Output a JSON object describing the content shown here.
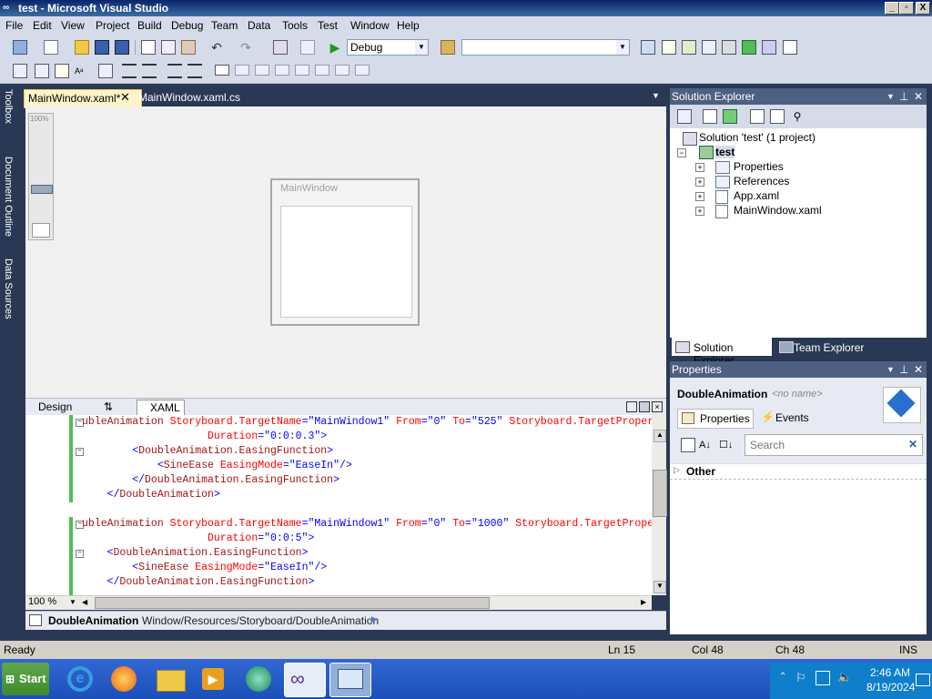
{
  "window": {
    "title": "test - Microsoft Visual Studio",
    "caption_buttons": [
      "_",
      "▫",
      "X"
    ]
  },
  "menu": [
    "File",
    "Edit",
    "View",
    "Project",
    "Build",
    "Debug",
    "Team",
    "Data",
    "Tools",
    "Test",
    "Window",
    "Help"
  ],
  "toolbar": {
    "config": "Debug",
    "platform": ""
  },
  "left_dock": [
    "Toolbox",
    "Document Outline",
    "Data Sources"
  ],
  "doc_tabs": [
    {
      "label": "MainWindow.xaml*",
      "active": true
    },
    {
      "label": "MainWindow.xaml.cs",
      "active": false
    }
  ],
  "designer": {
    "zoom_label": "100%",
    "window_title": "MainWindow"
  },
  "split_tabs": {
    "design": "Design",
    "swap": "⇅",
    "xaml": "XAML"
  },
  "code_lines": [
    [
      [
        "tg",
        "ubleAnimation "
      ],
      [
        "at",
        "Storyboard.TargetName"
      ],
      [
        "br",
        "="
      ],
      [
        "vl",
        "\"MainWindow1\""
      ],
      [
        "at",
        " From"
      ],
      [
        "br",
        "="
      ],
      [
        "vl",
        "\"0\""
      ],
      [
        "at",
        " To"
      ],
      [
        "br",
        "="
      ],
      [
        "vl",
        "\"525\""
      ],
      [
        "at",
        " Storyboard.TargetProperty"
      ]
    ],
    [
      [
        "at",
        "                    Duration"
      ],
      [
        "br",
        "="
      ],
      [
        "vl",
        "\"0:0:0.3\""
      ],
      [
        "br",
        ">"
      ]
    ],
    [
      [
        "br",
        "        <"
      ],
      [
        "tg",
        "DoubleAnimation.EasingFunction"
      ],
      [
        "br",
        ">"
      ]
    ],
    [
      [
        "br",
        "            <"
      ],
      [
        "tg",
        "SineEase"
      ],
      [
        "at",
        " EasingMode"
      ],
      [
        "br",
        "="
      ],
      [
        "vl",
        "\"EaseIn\""
      ],
      [
        "br",
        "/>"
      ]
    ],
    [
      [
        "br",
        "        </"
      ],
      [
        "tg",
        "DoubleAnimation.EasingFunction"
      ],
      [
        "br",
        ">"
      ]
    ],
    [
      [
        "br",
        "    </"
      ],
      [
        "tg",
        "DoubleAnimation"
      ],
      [
        "br",
        ">"
      ]
    ],
    [
      [
        "br",
        ""
      ]
    ],
    [
      [
        "tg",
        "ubleAnimation "
      ],
      [
        "at",
        "Storyboard.TargetName"
      ],
      [
        "br",
        "="
      ],
      [
        "vl",
        "\"MainWindow1\""
      ],
      [
        "at",
        " From"
      ],
      [
        "br",
        "="
      ],
      [
        "vl",
        "\"0\""
      ],
      [
        "at",
        " To"
      ],
      [
        "br",
        "="
      ],
      [
        "vl",
        "\"1000\""
      ],
      [
        "at",
        " Storyboard.TargetPropert"
      ]
    ],
    [
      [
        "at",
        "                    Duration"
      ],
      [
        "br",
        "="
      ],
      [
        "vl",
        "\"0:0:5\""
      ],
      [
        "br",
        ">"
      ]
    ],
    [
      [
        "br",
        "    <"
      ],
      [
        "tg",
        "DoubleAnimation.EasingFunction"
      ],
      [
        "br",
        ">"
      ]
    ],
    [
      [
        "br",
        "        <"
      ],
      [
        "tg",
        "SineEase"
      ],
      [
        "at",
        " EasingMode"
      ],
      [
        "br",
        "="
      ],
      [
        "vl",
        "\"EaseIn\""
      ],
      [
        "br",
        "/>"
      ]
    ],
    [
      [
        "br",
        "    </"
      ],
      [
        "tg",
        "DoubleAnimation.EasingFunction"
      ],
      [
        "br",
        ">"
      ]
    ]
  ],
  "code_zoom": "100 %",
  "navbar": {
    "element": "DoubleAnimation",
    "path": "Window/Resources/Storyboard/DoubleAnimation"
  },
  "solution_explorer": {
    "title": "Solution Explorer",
    "solution": "Solution 'test' (1 project)",
    "project": "test",
    "items": [
      "Properties",
      "References",
      "App.xaml",
      "MainWindow.xaml"
    ],
    "bottom_tabs": [
      "Solution Explorer",
      "Team Explorer"
    ]
  },
  "properties": {
    "title": "Properties",
    "object_type": "DoubleAnimation",
    "object_name": "<no name>",
    "tabs": [
      "Properties",
      "Events"
    ],
    "search_placeholder": "Search",
    "category": "Other"
  },
  "status": {
    "ready": "Ready",
    "ln": "Ln 15",
    "col": "Col 48",
    "ch": "Ch 48",
    "mode": "INS"
  },
  "taskbar": {
    "start": "Start",
    "time": "2:46 AM",
    "date": "8/19/2024"
  }
}
